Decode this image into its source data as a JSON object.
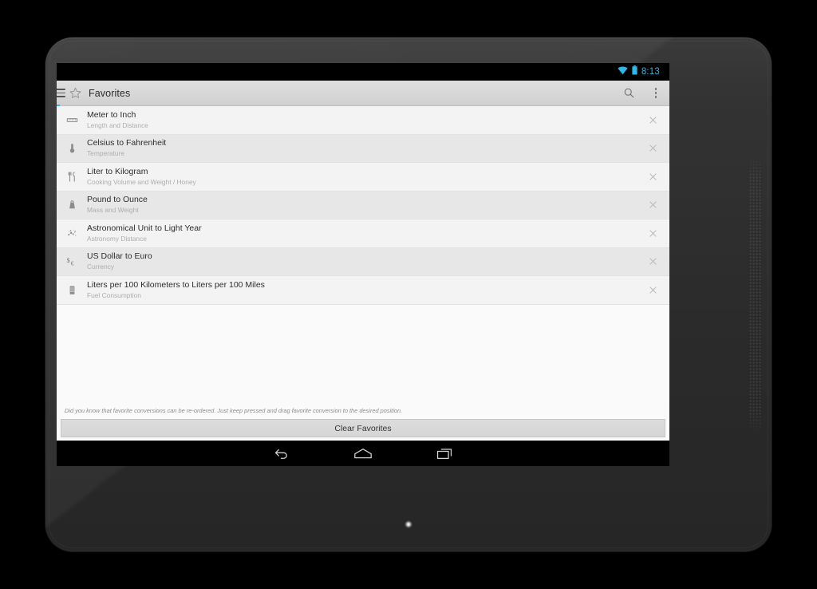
{
  "status_bar": {
    "wifi_icon": "wifi-icon",
    "battery_icon": "battery-icon",
    "clock": "8:13",
    "accent_color": "#33b5e5"
  },
  "action_bar": {
    "drawer_icon": "hamburger-menu-icon",
    "app_icon": "star-outline-icon",
    "title": "Favorites",
    "search_icon": "search-icon",
    "overflow_icon": "overflow-menu-icon"
  },
  "favorites": {
    "items": [
      {
        "icon": "ruler-icon",
        "title": "Meter to Inch",
        "subtitle": "Length and Distance",
        "remove_icon": "close-icon"
      },
      {
        "icon": "thermometer-icon",
        "title": "Celsius to Fahrenheit",
        "subtitle": "Temperature",
        "remove_icon": "close-icon"
      },
      {
        "icon": "cutlery-icon",
        "title": "Liter to Kilogram",
        "subtitle": "Cooking Volume and Weight / Honey",
        "remove_icon": "close-icon"
      },
      {
        "icon": "weight-icon",
        "title": "Pound to Ounce",
        "subtitle": "Mass and Weight",
        "remove_icon": "close-icon"
      },
      {
        "icon": "constellation-icon",
        "title": "Astronomical Unit to Light Year",
        "subtitle": "Astronomy Distance",
        "remove_icon": "close-icon"
      },
      {
        "icon": "currency-icon",
        "title": "US Dollar to Euro",
        "subtitle": "Currency",
        "remove_icon": "close-icon"
      },
      {
        "icon": "fuel-canister-icon",
        "title": "Liters per 100 Kilometers to Liters per 100 Miles",
        "subtitle": "Fuel Consumption",
        "remove_icon": "close-icon"
      }
    ]
  },
  "footer": {
    "hint": "Did you know that favorite conversions can be re-ordered. Just keep pressed and drag favorite conversion to the desired position.",
    "clear_button_label": "Clear Favorites"
  },
  "navigation_bar": {
    "back_icon": "back-arrow-icon",
    "home_icon": "home-icon",
    "recents_icon": "recent-apps-icon"
  }
}
